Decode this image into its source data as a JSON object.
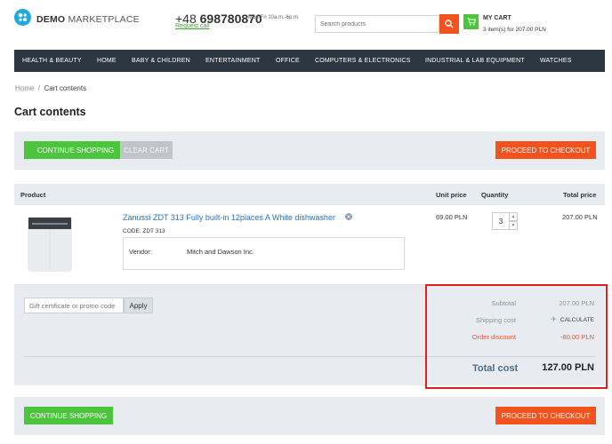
{
  "header": {
    "logo_bold": "DEMO",
    "logo_rest": "MARKETPLACE",
    "phone_code": "+48",
    "phone_number": "698780870",
    "hours": "Mon-Fri 10a.m.-6p.m.",
    "request_call": "Request call",
    "search_placeholder": "Search products",
    "cart_title": "MY CART",
    "cart_summary": "3 item(s) for 207.00 PLN"
  },
  "nav": [
    "HEALTH & BEAUTY",
    "HOME",
    "BABY & CHILDREN",
    "ENTERTAINMENT",
    "OFFICE",
    "COMPUTERS & ELECTRONICS",
    "INDUSTRIAL & LAB EQUIPMENT",
    "WATCHES"
  ],
  "breadcrumb": {
    "home": "Home",
    "sep": "/",
    "current": "Cart contents"
  },
  "page_title": "Cart contents",
  "buttons": {
    "continue": "CONTINUE SHOPPING",
    "clear": "CLEAR CART",
    "checkout": "PROCEED TO CHECKOUT",
    "apply": "Apply"
  },
  "table": {
    "headers": {
      "product": "Product",
      "unit_price": "Unit price",
      "quantity": "Quantity",
      "total_price": "Total price"
    },
    "item": {
      "name": "Zanussi ZDT 313 Fully built-in 12places A White dishwasher",
      "code": "CODE: ZDT 313",
      "vendor_label": "Vendor:",
      "vendor": "Mitch and Dawson Inc.",
      "unit_price": "69.00 PLN",
      "quantity": "3",
      "total": "207.00 PLN"
    }
  },
  "summary": {
    "promo_placeholder": "Gift certificate or promo code",
    "subtotal_label": "Subtotal",
    "subtotal": "207.00 PLN",
    "shipping_label": "Shipping cost",
    "shipping_action": "CALCULATE",
    "discount_label": "Order discount",
    "discount": "-80.00 PLN",
    "total_label": "Total cost",
    "total": "127.00 PLN"
  },
  "colors": {
    "accent_green": "#4bc53b",
    "accent_orange": "#f1521e",
    "nav_bg": "#2d3741",
    "highlight_red": "#e0201f"
  }
}
